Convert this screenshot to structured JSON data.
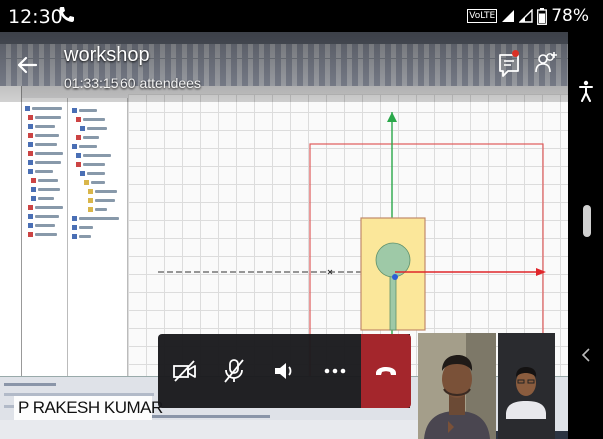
{
  "status_bar": {
    "time": "12:30",
    "network_badge": "VoLTE",
    "battery": "78%"
  },
  "meeting": {
    "title": "workshop",
    "elapsed": "01:33:15",
    "attendees": "60 attendees"
  },
  "presenter": {
    "name": "P RAKESH KUMAR"
  },
  "controls": {
    "video": "video-off-icon",
    "mic": "mic-off-icon",
    "speaker": "speaker-icon",
    "more": "more-icon",
    "hangup": "hangup-icon"
  },
  "colors": {
    "hangup": "#a4262c",
    "controls_bg": "#19191c",
    "chat_badge": "#d93025",
    "cad_patch": "#fbe79a",
    "cad_circle": "#9ec9a7",
    "cad_axis_red": "#e0262b",
    "cad_axis_green": "#2aa84a"
  }
}
